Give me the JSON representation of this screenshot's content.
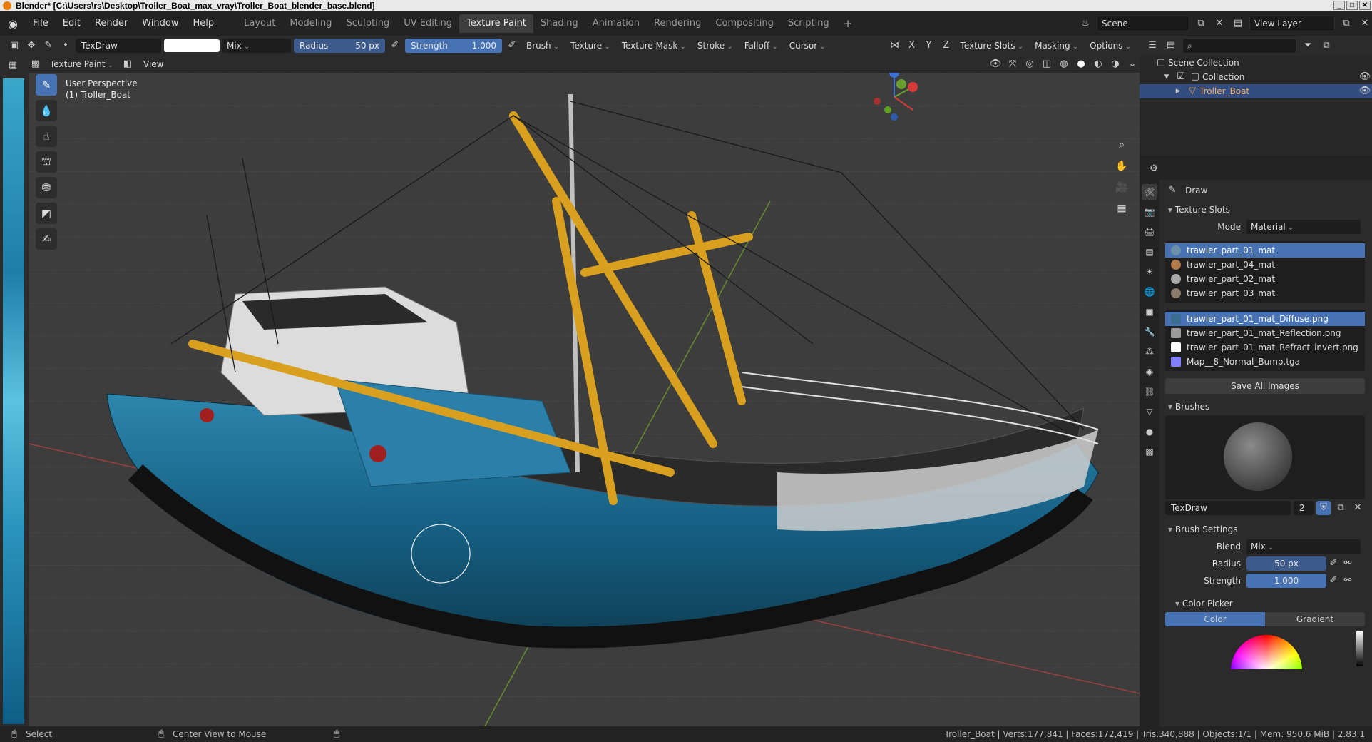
{
  "window": {
    "title": "Blender* [C:\\Users\\rs\\Desktop\\Troller_Boat_max_vray\\Troller_Boat_blender_base.blend]",
    "controls": [
      "_",
      "□",
      "✕"
    ]
  },
  "menu": [
    "File",
    "Edit",
    "Render",
    "Window",
    "Help"
  ],
  "workspaces": [
    {
      "label": "Layout"
    },
    {
      "label": "Modeling"
    },
    {
      "label": "Sculpting"
    },
    {
      "label": "UV Editing"
    },
    {
      "label": "Texture Paint"
    },
    {
      "label": "Shading"
    },
    {
      "label": "Animation"
    },
    {
      "label": "Rendering"
    },
    {
      "label": "Compositing"
    },
    {
      "label": "Scripting"
    }
  ],
  "active_workspace": "Texture Paint",
  "plus": "+",
  "scene": {
    "name": "Scene",
    "view_layer": "View Layer"
  },
  "tool_settings": {
    "brush_name": "TexDraw",
    "blend": "Mix",
    "radius_label": "Radius",
    "radius_value": "50 px",
    "strength_label": "Strength",
    "strength_value": "1.000",
    "strength_fill": 1.0,
    "menus": [
      "Brush",
      "Texture",
      "Texture Mask",
      "Stroke",
      "Falloff",
      "Cursor"
    ],
    "axes": [
      "X",
      "Y",
      "Z"
    ],
    "right_menus": [
      "Texture Slots",
      "Masking",
      "Options"
    ]
  },
  "header": {
    "mode": "Texture Paint",
    "view": "View"
  },
  "viewport": {
    "perspective": "User Perspective",
    "object": "(1) Troller_Boat"
  },
  "gizmo": {
    "x": "X",
    "y": "Y",
    "z": "Z"
  },
  "outliner": {
    "scene_collection": "Scene Collection",
    "collection": "Collection",
    "object": "Troller_Boat"
  },
  "properties": {
    "tool_name": "Draw",
    "texture_slots": {
      "title": "Texture Slots",
      "mode_label": "Mode",
      "mode_value": "Material",
      "materials": [
        "trawler_part_01_mat",
        "trawler_part_04_mat",
        "trawler_part_02_mat",
        "trawler_part_03_mat"
      ],
      "images": [
        {
          "name": "trawler_part_01_mat_Diffuse.png",
          "color": "#3a6d8f"
        },
        {
          "name": "trawler_part_01_mat_Reflection.png",
          "color": "#9a9a9a"
        },
        {
          "name": "trawler_part_01_mat_Refract_invert.png",
          "color": "#ffffff"
        },
        {
          "name": "Map__8_Normal_Bump.tga",
          "color": "#8080ff"
        }
      ],
      "save_all": "Save All Images"
    },
    "brushes": {
      "title": "Brushes",
      "brush_name": "TexDraw",
      "users": "2"
    },
    "brush_settings": {
      "title": "Brush Settings",
      "blend_label": "Blend",
      "blend_value": "Mix",
      "radius_label": "Radius",
      "radius_value": "50 px",
      "strength_label": "Strength",
      "strength_value": "1.000"
    },
    "color_picker": {
      "title": "Color Picker",
      "tabs": [
        "Color",
        "Gradient"
      ]
    }
  },
  "statusbar": {
    "select": "Select",
    "center": "Center View to Mouse",
    "stats": "Troller_Boat | Verts:177,841 | Faces:172,419 | Tris:340,888 | Objects:1/1 | Mem: 950.6 MiB | 2.83.1"
  },
  "colors": {
    "accent": "#4772b3",
    "hull_blue": "#1f6f96",
    "crane": "#e0a020",
    "grid": "#4a4a4a"
  }
}
